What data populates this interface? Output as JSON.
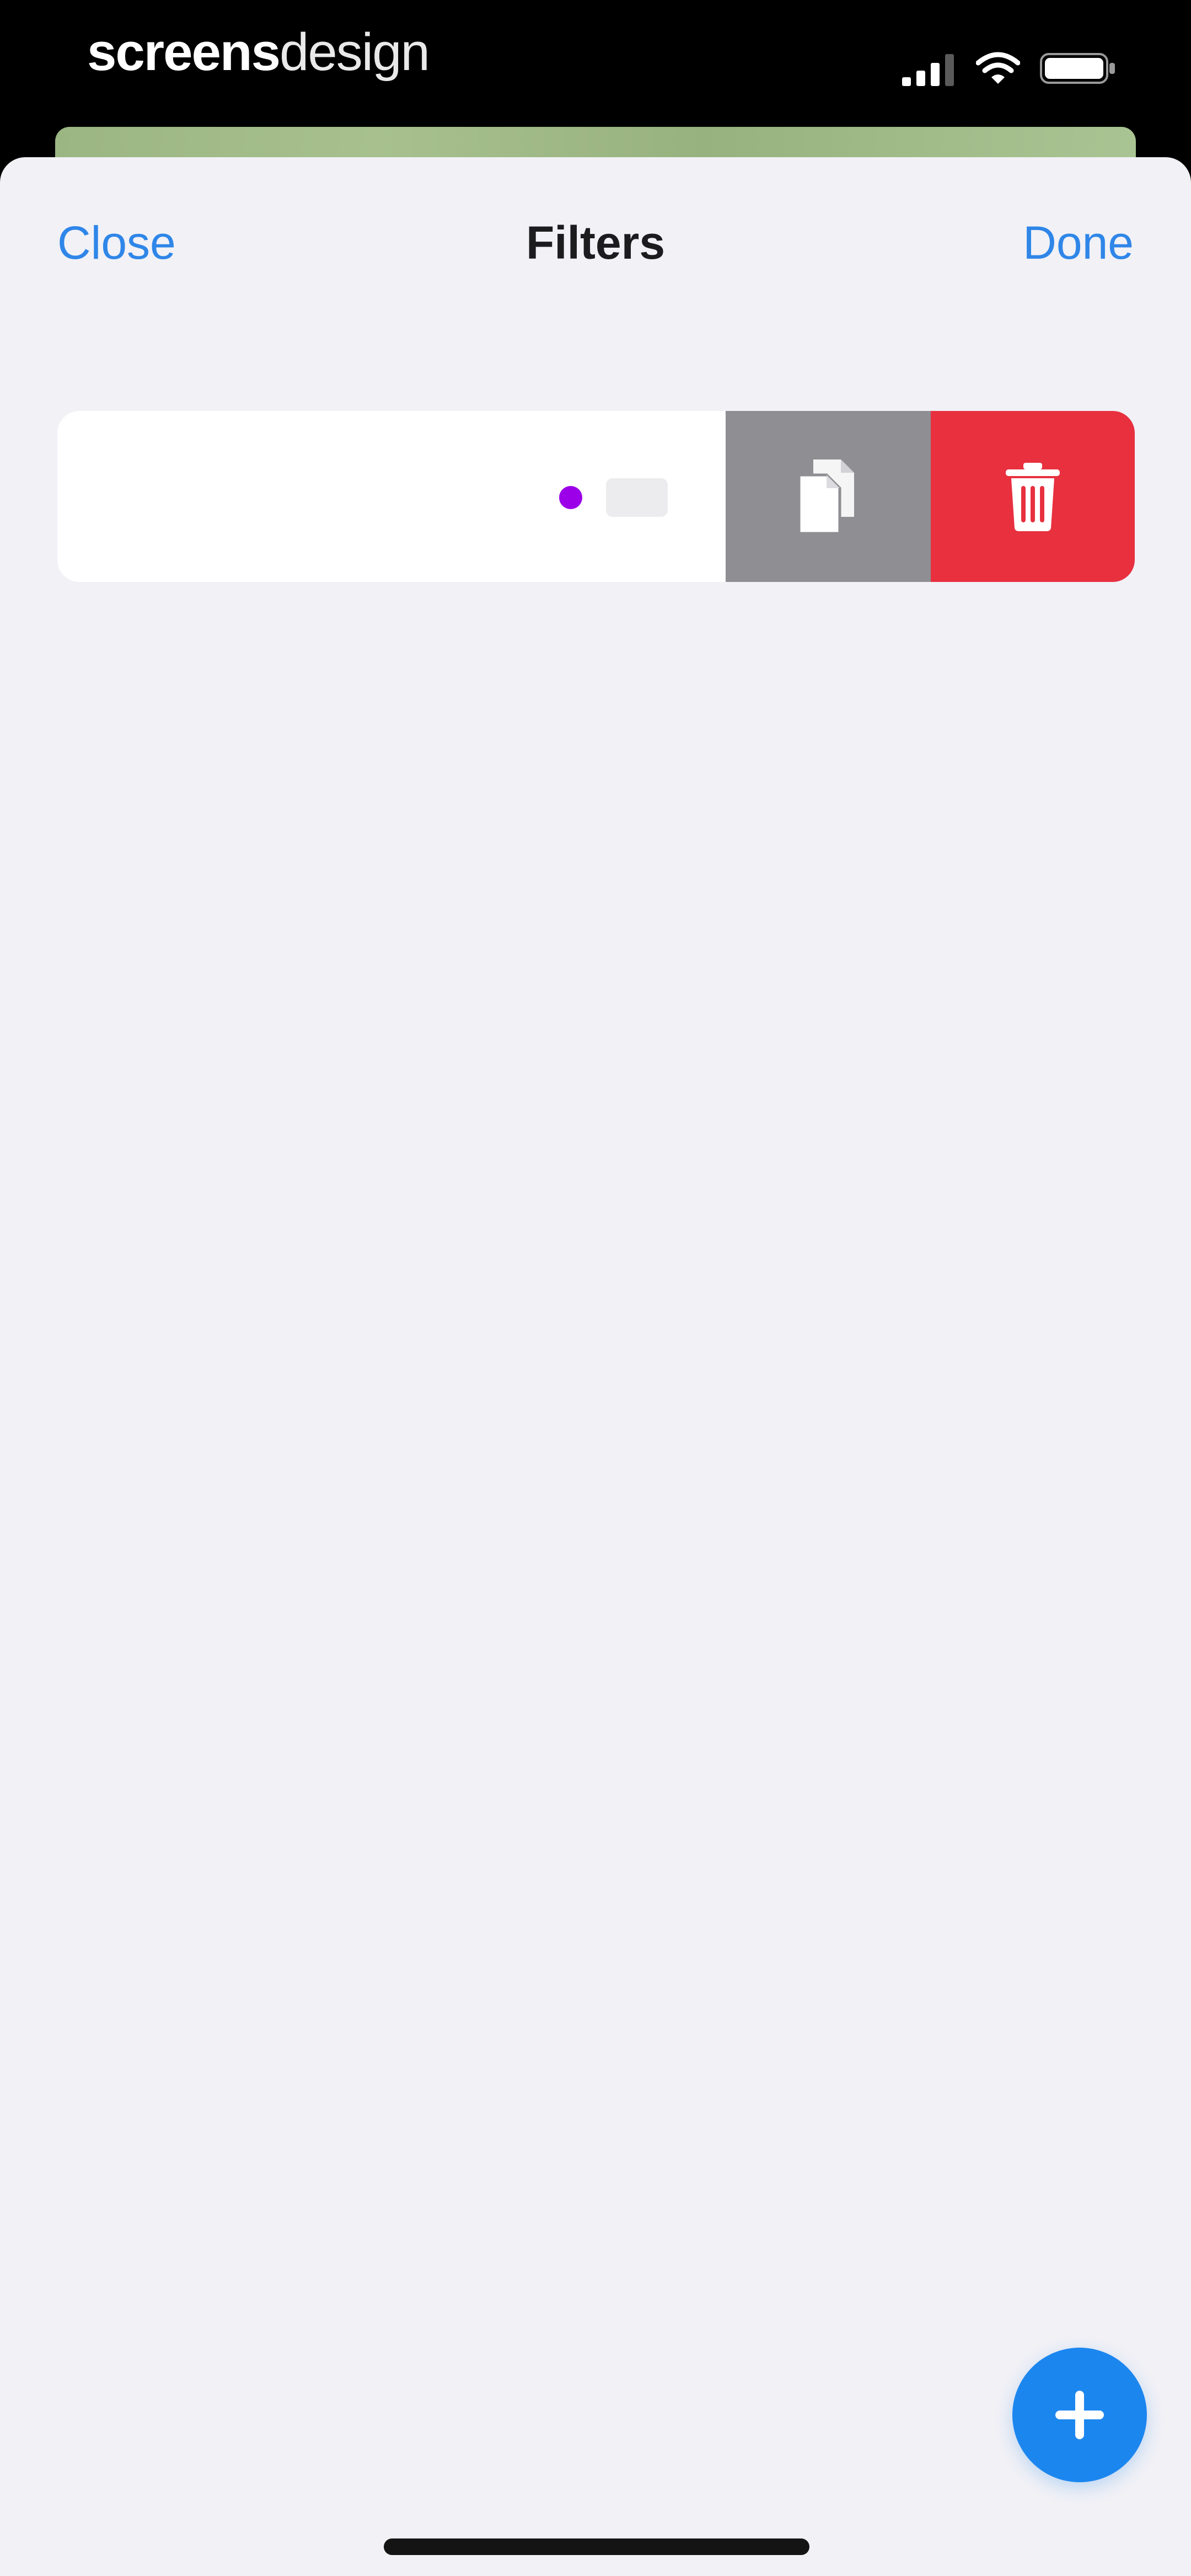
{
  "status_bar": {
    "brand_part1": "screens",
    "brand_part2": "design",
    "icons": [
      "signal-icon",
      "wifi-icon",
      "battery-icon"
    ]
  },
  "nav": {
    "close_label": "Close",
    "title": "Filters",
    "done_label": "Done"
  },
  "filter_row": {
    "label": "",
    "dot_color": "#9b00e8",
    "actions": {
      "duplicate_icon": "duplicate-icon",
      "delete_icon": "trash-icon"
    }
  },
  "fab": {
    "icon": "plus-icon"
  },
  "colors": {
    "accent": "#2f86e8",
    "delete": "#e8303f",
    "duplicate": "#8e8e93",
    "fab": "#1c86ef",
    "sheet_background": "#f1f1f6"
  }
}
